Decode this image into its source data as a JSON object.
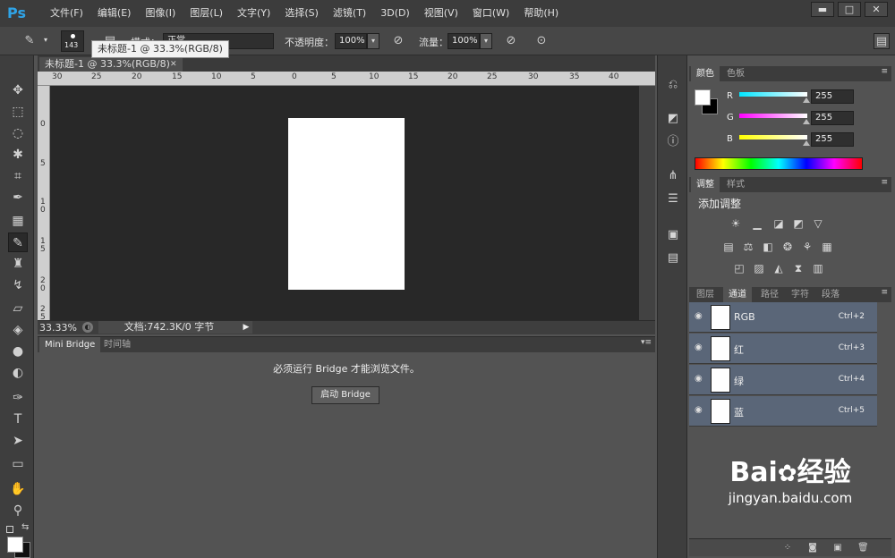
{
  "app": {
    "logo": "Ps"
  },
  "menu": [
    "文件(F)",
    "编辑(E)",
    "图像(I)",
    "图层(L)",
    "文字(Y)",
    "选择(S)",
    "滤镜(T)",
    "3D(D)",
    "视图(V)",
    "窗口(W)",
    "帮助(H)"
  ],
  "window_controls": {
    "minimize": "▬",
    "maximize": "□",
    "close": "✕"
  },
  "options": {
    "brush_size": "143",
    "mode_label": "模式：",
    "mode_value": "正常",
    "opacity_label": "不透明度：",
    "opacity_value": "100%",
    "flow_label": "流量：",
    "flow_value": "100%"
  },
  "tooltip": "未标题-1 @ 33.3%(RGB/8)",
  "document": {
    "tab_title": "未标题-1 @ 33.3%(RGB/8)",
    "tab_close": "✕",
    "ruler_h": [
      "30",
      "25",
      "20",
      "15",
      "10",
      "5",
      "0",
      "5",
      "10",
      "15",
      "20",
      "25",
      "30",
      "35",
      "40"
    ],
    "ruler_v": [
      "0",
      "5",
      "1\n0",
      "1\n5",
      "2\n0",
      "2\n5"
    ],
    "zoom": "33.33%",
    "doc_info": "文档:742.3K/0 字节"
  },
  "bridge": {
    "tabs": [
      "Mini Bridge",
      "时间轴"
    ],
    "message": "必须运行 Bridge 才能浏览文件。",
    "button": "启动 Bridge"
  },
  "color_panel": {
    "tabs": [
      "颜色",
      "色板"
    ],
    "channels": [
      {
        "label": "R",
        "value": "255",
        "color": "#00e5ff"
      },
      {
        "label": "G",
        "value": "255",
        "color": "#ff00ff"
      },
      {
        "label": "B",
        "value": "255",
        "color": "#ffff00"
      }
    ]
  },
  "adjust_panel": {
    "tabs": [
      "调整",
      "样式"
    ],
    "title": "添加调整"
  },
  "channels_panel": {
    "tabs": [
      "图层",
      "通道",
      "路径",
      "字符",
      "段落"
    ],
    "rows": [
      {
        "name": "RGB",
        "key": "Ctrl+2"
      },
      {
        "name": "红",
        "key": "Ctrl+3"
      },
      {
        "name": "绿",
        "key": "Ctrl+4"
      },
      {
        "name": "蓝",
        "key": "Ctrl+5"
      }
    ]
  },
  "watermark": {
    "brand": "Bai",
    "brand2": "经验",
    "url": "jingyan.baidu.com"
  }
}
